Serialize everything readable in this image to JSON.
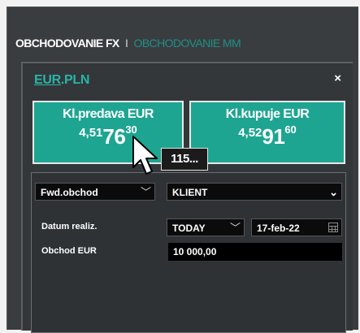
{
  "tabs": {
    "active": "OBCHODOVANIE FX",
    "separator": "I",
    "inactive": "OBCHODOVANIE MM"
  },
  "pair": {
    "base": "EUR",
    "dot": ".",
    "quote": "PLN"
  },
  "close": "×",
  "sell": {
    "title": "Kl.predava EUR",
    "lead": "4,51",
    "big": "76",
    "pip": "30"
  },
  "buy": {
    "title": "Kl.kupuje EUR",
    "lead": "4,52",
    "big": "91",
    "pip": "60"
  },
  "spread": "115...",
  "form": {
    "trade_type": "Fwd.obchod",
    "client": "KLIENT",
    "date_label": "Datum realiz.",
    "date_option": "TODAY",
    "date_value": "17-feb-22",
    "amount_label": "Obchod EUR",
    "amount_value": "10 000,00"
  },
  "icons": {
    "close": "close-icon",
    "chevron": "chevron-down-icon",
    "calendar": "calendar-icon",
    "cursor": "mouse-cursor-icon"
  },
  "colors": {
    "panel_bg": "#3a3d40",
    "accent": "#1ea592",
    "link": "#28b5a6"
  }
}
